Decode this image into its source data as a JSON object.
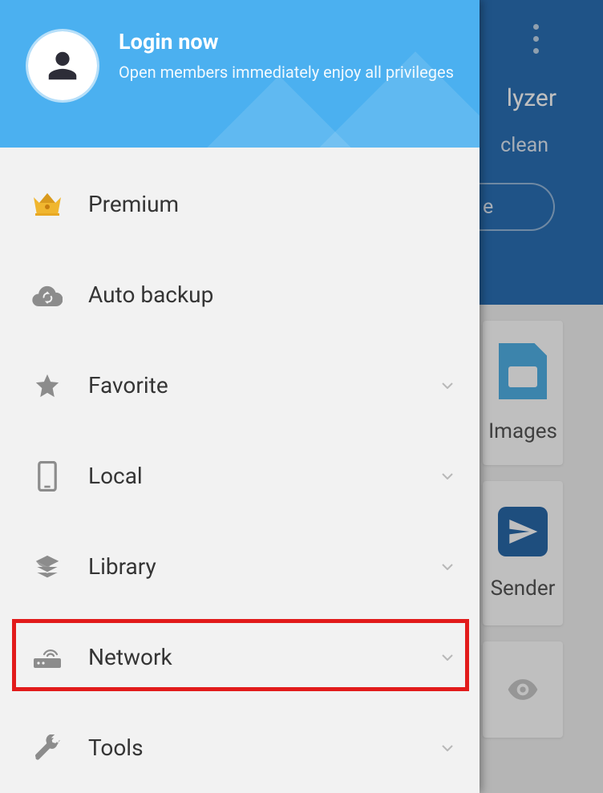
{
  "background": {
    "title_partial": "lyzer",
    "subtitle_partial": "clean",
    "button_partial": "e",
    "card_images_label": "Images",
    "card_sender_label": "Sender"
  },
  "drawer": {
    "login": {
      "title": "Login now",
      "subtitle": "Open members immediately enjoy all privileges"
    },
    "items": [
      {
        "label": "Premium",
        "icon": "crown",
        "expandable": false
      },
      {
        "label": "Auto backup",
        "icon": "cloud-sync",
        "expandable": false
      },
      {
        "label": "Favorite",
        "icon": "star",
        "expandable": true
      },
      {
        "label": "Local",
        "icon": "phone",
        "expandable": true
      },
      {
        "label": "Library",
        "icon": "layers",
        "expandable": true
      },
      {
        "label": "Network",
        "icon": "router",
        "expandable": true
      },
      {
        "label": "Tools",
        "icon": "wrench",
        "expandable": true
      }
    ]
  },
  "highlight_item_index": 5
}
